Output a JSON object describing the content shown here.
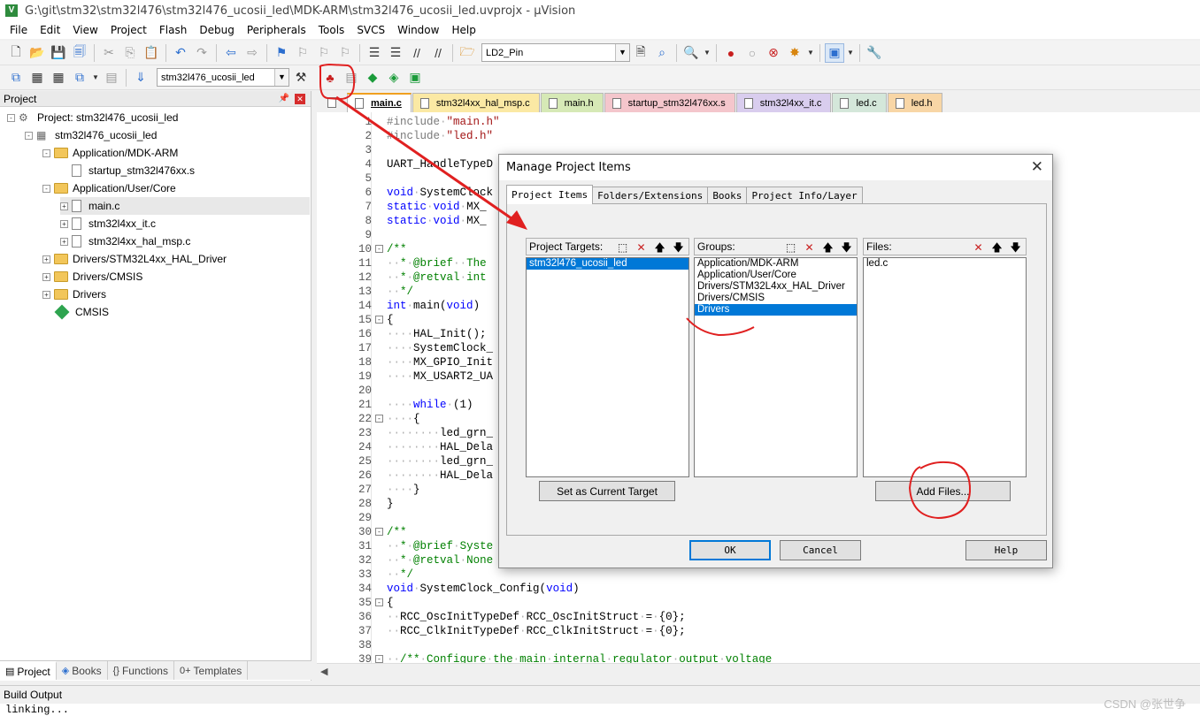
{
  "window": {
    "title": "G:\\git\\stm32\\stm32l476\\stm32l476_ucosii_led\\MDK-ARM\\stm32l476_ucosii_led.uvprojx - µVision",
    "app_icon": "V"
  },
  "menu": [
    "File",
    "Edit",
    "View",
    "Project",
    "Flash",
    "Debug",
    "Peripherals",
    "Tools",
    "SVCS",
    "Window",
    "Help"
  ],
  "toolbar": {
    "find_combo_value": "LD2_Pin",
    "target_combo_value": "stm32l476_ucosii_led"
  },
  "project_panel": {
    "title": "Project",
    "tree": [
      {
        "label": "Project: stm32l476_ucosii_led",
        "level": 0,
        "kind": "project",
        "expander": "-"
      },
      {
        "label": "stm32l476_ucosii_led",
        "level": 1,
        "kind": "target",
        "expander": "-"
      },
      {
        "label": "Application/MDK-ARM",
        "level": 2,
        "kind": "folder",
        "expander": "-"
      },
      {
        "label": "startup_stm32l476xx.s",
        "level": 3,
        "kind": "file",
        "expander": ""
      },
      {
        "label": "Application/User/Core",
        "level": 2,
        "kind": "folder",
        "expander": "-"
      },
      {
        "label": "main.c",
        "level": 3,
        "kind": "file",
        "expander": "+",
        "selected": true
      },
      {
        "label": "stm32l4xx_it.c",
        "level": 3,
        "kind": "file",
        "expander": "+"
      },
      {
        "label": "stm32l4xx_hal_msp.c",
        "level": 3,
        "kind": "file",
        "expander": "+"
      },
      {
        "label": "Drivers/STM32L4xx_HAL_Driver",
        "level": 2,
        "kind": "folder",
        "expander": "+"
      },
      {
        "label": "Drivers/CMSIS",
        "level": 2,
        "kind": "folder",
        "expander": "+"
      },
      {
        "label": "Drivers",
        "level": 2,
        "kind": "folder",
        "expander": "+"
      },
      {
        "label": "CMSIS",
        "level": 2,
        "kind": "component",
        "expander": ""
      }
    ],
    "tabs": [
      {
        "label": "Project",
        "icon": "project-icon",
        "glyph": "▤"
      },
      {
        "label": "Books",
        "icon": "books-icon",
        "glyph": "◈"
      },
      {
        "label": "Functions",
        "icon": "functions-icon",
        "glyph": "{}"
      },
      {
        "label": "Templates",
        "icon": "templates-icon",
        "glyph": "0+"
      }
    ]
  },
  "editor": {
    "tabs": [
      {
        "label": "main.c",
        "color": "#ffffff",
        "active": true
      },
      {
        "label": "stm32l4xx_hal_msp.c",
        "color": "#fbe9a4"
      },
      {
        "label": "main.h",
        "color": "#d6e9b6"
      },
      {
        "label": "startup_stm32l476xx.s",
        "color": "#f4c6cc"
      },
      {
        "label": "stm32l4xx_it.c",
        "color": "#d9cdee"
      },
      {
        "label": "led.c",
        "color": "#d4e7da"
      },
      {
        "label": "led.h",
        "color": "#f8d6a6"
      }
    ],
    "lines": [
      {
        "n": "1",
        "html": "<span class=\"pp\">#include</span><span class=\"dot\">·</span><span class=\"str\">\"main.h\"</span>"
      },
      {
        "n": "2",
        "html": "<span class=\"pp\">#include</span><span class=\"dot\">·</span><span class=\"str\">\"led.h\"</span>"
      },
      {
        "n": "3",
        "html": ""
      },
      {
        "n": "4",
        "html": "UART_HandleTypeD"
      },
      {
        "n": "5",
        "html": ""
      },
      {
        "n": "6",
        "html": "<span class=\"kw\">void</span><span class=\"dot\">·</span>SystemClock"
      },
      {
        "n": "7",
        "html": "<span class=\"kw\">static</span><span class=\"dot\">·</span><span class=\"kw\">void</span><span class=\"dot\">·</span>MX_"
      },
      {
        "n": "8",
        "html": "<span class=\"kw\">static</span><span class=\"dot\">·</span><span class=\"kw\">void</span><span class=\"dot\">·</span>MX_"
      },
      {
        "n": "9",
        "html": ""
      },
      {
        "n": "10",
        "html": "<span class=\"cm\">/**</span>",
        "fold": "-"
      },
      {
        "n": "11",
        "html": "<span class=\"dot\">··</span><span class=\"cm\">*</span><span class=\"dot\">·</span><span class=\"cm\">@brief</span><span class=\"dot\">··</span><span class=\"cm\">The</span>"
      },
      {
        "n": "12",
        "html": "<span class=\"dot\">··</span><span class=\"cm\">*</span><span class=\"dot\">·</span><span class=\"cm\">@retval</span><span class=\"dot\">·</span><span class=\"cm\">int</span>"
      },
      {
        "n": "13",
        "html": "<span class=\"dot\">··</span><span class=\"cm\">*/</span>"
      },
      {
        "n": "14",
        "html": "<span class=\"kw\">int</span><span class=\"dot\">·</span>main(<span class=\"kw\">void</span>)"
      },
      {
        "n": "15",
        "html": "{",
        "fold": "-"
      },
      {
        "n": "16",
        "html": "<span class=\"dot\">····</span>HAL_Init();"
      },
      {
        "n": "17",
        "html": "<span class=\"dot\">····</span>SystemClock_"
      },
      {
        "n": "18",
        "html": "<span class=\"dot\">····</span>MX_GPIO_Init"
      },
      {
        "n": "19",
        "html": "<span class=\"dot\">····</span>MX_USART2_UA"
      },
      {
        "n": "20",
        "html": ""
      },
      {
        "n": "21",
        "html": "<span class=\"dot\">····</span><span class=\"kw\">while</span><span class=\"dot\">·</span>(1)"
      },
      {
        "n": "22",
        "html": "<span class=\"dot\">····</span>{",
        "fold": "-"
      },
      {
        "n": "23",
        "html": "<span class=\"dot\">········</span>led_grn_"
      },
      {
        "n": "24",
        "html": "<span class=\"dot\">········</span>HAL_Dela"
      },
      {
        "n": "25",
        "html": "<span class=\"dot\">········</span>led_grn_"
      },
      {
        "n": "26",
        "html": "<span class=\"dot\">········</span>HAL_Dela"
      },
      {
        "n": "27",
        "html": "<span class=\"dot\">····</span>}"
      },
      {
        "n": "28",
        "html": "}"
      },
      {
        "n": "29",
        "html": ""
      },
      {
        "n": "30",
        "html": "<span class=\"cm\">/**</span>",
        "fold": "-"
      },
      {
        "n": "31",
        "html": "<span class=\"dot\">··</span><span class=\"cm\">*</span><span class=\"dot\">·</span><span class=\"cm\">@brief</span><span class=\"dot\">·</span><span class=\"cm\">Syste</span>"
      },
      {
        "n": "32",
        "html": "<span class=\"dot\">··</span><span class=\"cm\">*</span><span class=\"dot\">·</span><span class=\"cm\">@retval</span><span class=\"dot\">·</span><span class=\"cm\">None</span>"
      },
      {
        "n": "33",
        "html": "<span class=\"dot\">··</span><span class=\"cm\">*/</span>"
      },
      {
        "n": "34",
        "html": "<span class=\"kw\">void</span><span class=\"dot\">·</span>SystemClock_Config(<span class=\"kw\">void</span>)"
      },
      {
        "n": "35",
        "html": "{",
        "fold": "-"
      },
      {
        "n": "36",
        "html": "<span class=\"dot\">··</span>RCC_OscInitTypeDef<span class=\"dot\">·</span>RCC_OscInitStruct<span class=\"dot\">·</span>=<span class=\"dot\">·</span>{0};"
      },
      {
        "n": "37",
        "html": "<span class=\"dot\">··</span>RCC_ClkInitTypeDef<span class=\"dot\">·</span>RCC_ClkInitStruct<span class=\"dot\">·</span>=<span class=\"dot\">·</span>{0};"
      },
      {
        "n": "38",
        "html": ""
      },
      {
        "n": "39",
        "html": "<span class=\"dot\">··</span><span class=\"cm\">/**</span><span class=\"dot\">·</span><span class=\"cm\">Configure</span><span class=\"dot\">·</span><span class=\"cm\">the</span><span class=\"dot\">·</span><span class=\"cm\">main</span><span class=\"dot\">·</span><span class=\"cm\">internal</span><span class=\"dot\">·</span><span class=\"cm\">regulator</span><span class=\"dot\">·</span><span class=\"cm\">output</span><span class=\"dot\">·</span><span class=\"cm\">voltage</span>",
        "fold": "-"
      }
    ]
  },
  "build_output": {
    "title": "Build Output",
    "text": "linking..."
  },
  "watermark": "CSDN @张世争",
  "dialog": {
    "title": "Manage Project Items",
    "close": "✕",
    "tabs": [
      "Project Items",
      "Folders/Extensions",
      "Books",
      "Project Info/Layer"
    ],
    "targets": {
      "header": "Project Targets:",
      "items": [
        "stm32l476_ucosii_led"
      ],
      "selected": 0
    },
    "groups": {
      "header": "Groups:",
      "items": [
        "Application/MDK-ARM",
        "Application/User/Core",
        "Drivers/STM32L4xx_HAL_Driver",
        "Drivers/CMSIS",
        "Drivers"
      ],
      "selected": 4
    },
    "files": {
      "header": "Files:",
      "items": [
        "led.c"
      ]
    },
    "set_current_target": "Set as Current Target",
    "add_files": "Add Files...",
    "ok": "OK",
    "cancel": "Cancel",
    "help": "Help"
  },
  "colors": {
    "selection": "#0078d7",
    "annotation": "#e02020"
  }
}
